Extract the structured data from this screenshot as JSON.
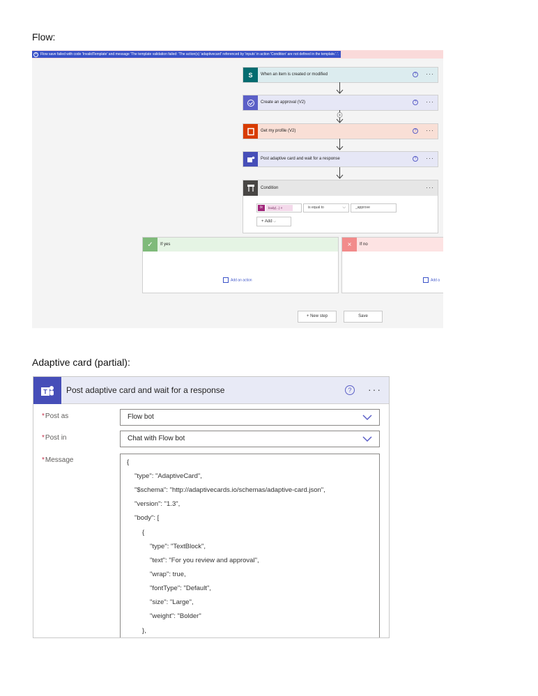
{
  "headings": {
    "flow": "Flow:",
    "card": "Adaptive card (partial):"
  },
  "error": {
    "message": "Flow save failed with code 'InvalidTemplate' and message 'The template validation failed: 'The action(s) 'adaptivecard' referenced by 'inputs' in action 'Condition' are not defined in the template.'.'."
  },
  "steps": [
    {
      "title": "When an item is created or modified",
      "icon": "sharepoint-icon",
      "icon_text": "S",
      "color": "#036c70",
      "tint": "#dcecef"
    },
    {
      "title": "Create an approval (V2)",
      "icon": "approval-icon",
      "icon_text": "",
      "color": "#5b5fc7",
      "tint": "#e6e7f6"
    },
    {
      "title": "Get my profile (V2)",
      "icon": "office-icon",
      "icon_text": "",
      "color": "#d83b01",
      "tint": "#f9dfd6"
    },
    {
      "title": "Post adaptive card and wait for a response",
      "icon": "teams-icon",
      "icon_text": "",
      "color": "#464eb8",
      "tint": "#e6e7f6"
    }
  ],
  "condition": {
    "title": "Condition",
    "token_label": "body(...)",
    "operator": "is equal to",
    "value": "_approve",
    "add_label": "Add"
  },
  "branches": {
    "yes": {
      "label": "If yes",
      "add_action": "Add an action",
      "color": "#7fba7a",
      "tint": "#e5f4e4"
    },
    "no": {
      "label": "If no",
      "add_action": "Add a",
      "color": "#f28b8b",
      "tint": "#fde3e3"
    }
  },
  "buttons": {
    "new_step": "+ New step",
    "save": "Save"
  },
  "card": {
    "title": "Post adaptive card and wait for a response",
    "post_as_label": "Post as",
    "post_as_value": "Flow bot",
    "post_in_label": "Post in",
    "post_in_value": "Chat with Flow bot",
    "message_label": "Message",
    "code_lines": [
      "{",
      "\"type\": \"AdaptiveCard\",",
      "\"$schema\": \"http://adaptivecards.io/schemas/adaptive-card.json\",",
      "\"version\": \"1.3\",",
      "\"body\": [",
      "{",
      "\"type\": \"TextBlock\",",
      "\"text\": \"For you review and approval\",",
      "\"wrap\": true,",
      "\"fontType\": \"Default\",",
      "\"size\": \"Large\",",
      "\"weight\": \"Bolder\"",
      "},"
    ]
  },
  "colors": {
    "accent": "#5b5fc7",
    "error_bg": "#fadada",
    "error_highlight": "#3a52c8",
    "required": "#c4314b"
  }
}
